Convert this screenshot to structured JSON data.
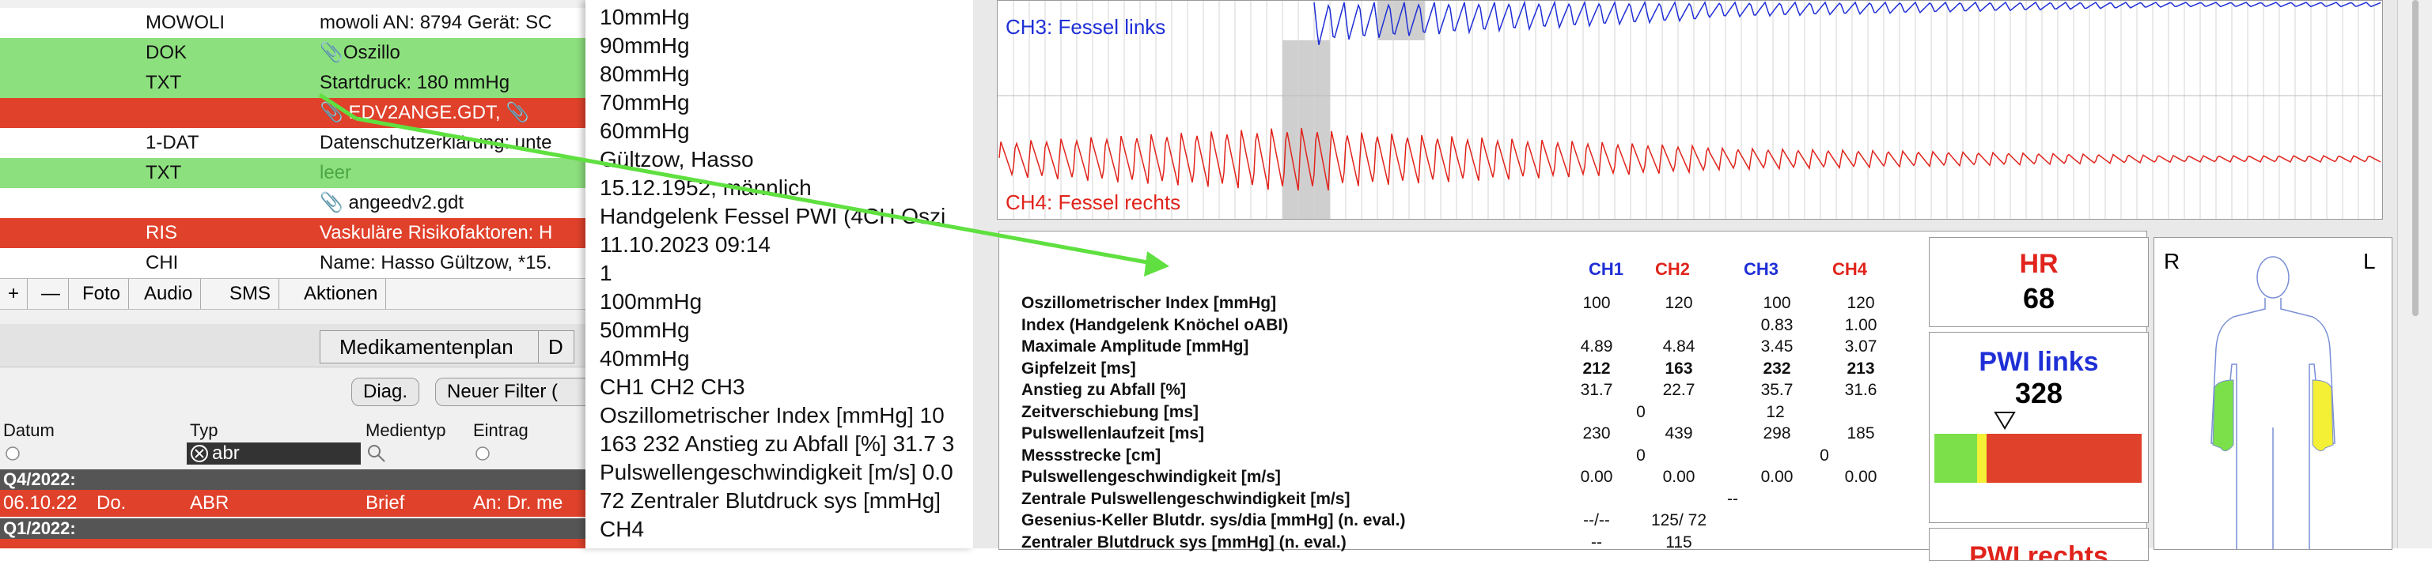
{
  "left_list": [
    {
      "c1": "MOWOLI",
      "c2": "mowoli AN: 8794 Gerät: SC",
      "style": "white"
    },
    {
      "c1": "DOK",
      "c2": "📎Oszillo",
      "style": "green"
    },
    {
      "c1": "TXT",
      "c2": "Startdruck: 180 mmHg",
      "style": "green"
    },
    {
      "c1": "",
      "c2": "📎 EDV2ANGE.GDT,  📎",
      "style": "red"
    },
    {
      "c1": "1-DAT",
      "c2": "Datenschutzerklärung: unte",
      "style": "white"
    },
    {
      "c1": "TXT",
      "c2": "leer",
      "style": "green"
    },
    {
      "c1": "",
      "c2": "📎 angeedv2.gdt",
      "style": "white"
    },
    {
      "c1": "RIS",
      "c2": "Vaskuläre Risikofaktoren: H",
      "style": "red"
    },
    {
      "c1": "CHI",
      "c2": "Name: Hasso Gültzow, *15.",
      "style": "white"
    }
  ],
  "toolbar": {
    "plus": "+",
    "minus": "—",
    "foto": "Foto",
    "audio": "Audio",
    "sms": "SMS",
    "aktionen": "Aktionen"
  },
  "buttons": {
    "medikamentenplan": "Medikamentenplan",
    "d": "D",
    "diag": "Diag.",
    "neuer_filter": "Neuer Filter ("
  },
  "columns": {
    "datum": "Datum",
    "typ": "Typ",
    "medientyp": "Medientyp",
    "eintrag": "Eintrag"
  },
  "filter": {
    "typ_value": "abr"
  },
  "groups": {
    "g1": "Q4/2022:",
    "g2": "Q1/2022:"
  },
  "data_rows": [
    {
      "datum": "06.10.22",
      "tag": "Do.",
      "typ": "ABR",
      "medientyp": "Brief",
      "eintrag": "An:  Dr. me"
    }
  ],
  "middle_lines": [
    "10mmHg",
    "90mmHg",
    "80mmHg",
    "70mmHg",
    "60mmHg",
    "Gültzow, Hasso",
    "15.12.1952, männlich",
    "Handgelenk Fessel PWI (4CH Oszi",
    "11.10.2023 09:14",
    " 1",
    "100mmHg",
    "50mmHg",
    "40mmHg",
    "     CH1 CH2 CH3",
    "Oszillometrischer Index [mmHg] 10",
    "163 232 Anstieg zu Abfall [%] 31.7 3",
    "Pulswellengeschwindigkeit [m/s] 0.0",
    "72 Zentraler Blutdruck sys [mmHg]",
    "CH4"
  ],
  "chart": {
    "ch3_label": "CH3: Fessel links",
    "ch4_label": "CH4: Fessel rechts",
    "ch3_color": "#1f2fd6",
    "ch4_color": "#e0241c"
  },
  "report": {
    "headers": [
      {
        "label": "CH1",
        "color": "#1f2fd6"
      },
      {
        "label": "CH2",
        "color": "#e0241c"
      },
      {
        "label": "CH3",
        "color": "#1f2fd6"
      },
      {
        "label": "CH4",
        "color": "#e0241c"
      }
    ],
    "rows": [
      {
        "label": "Oszillometrischer Index [mmHg]",
        "v": [
          "100",
          "120",
          "100",
          "120"
        ],
        "bold": false
      },
      {
        "label": "Index (Handgelenk Knöchel oABI)",
        "v": [
          "",
          "",
          "0.83",
          "1.00"
        ],
        "bold": false
      },
      {
        "label": "Maximale Amplitude [mmHg]",
        "v": [
          "4.89",
          "4.84",
          "3.45",
          "3.07"
        ],
        "bold": false
      },
      {
        "label": "Gipfelzeit [ms]",
        "v": [
          "212",
          "163",
          "232",
          "213"
        ],
        "bold": true
      },
      {
        "label": "Anstieg zu Abfall [%]",
        "v": [
          "31.7",
          "22.7",
          "35.7",
          "31.6"
        ],
        "bold": false
      },
      {
        "label": "Zeitverschiebung [ms]",
        "v": [
          "0",
          "",
          "12",
          ""
        ],
        "bold": false
      },
      {
        "label": "Pulswellenlaufzeit [ms]",
        "v": [
          "230",
          "439",
          "298",
          "185"
        ],
        "bold": false
      },
      {
        "label": "Messstrecke [cm]",
        "v": [
          "0",
          "",
          "0",
          ""
        ],
        "bold": false
      },
      {
        "label": "Pulswellengeschwindigkeit [m/s]",
        "v": [
          "0.00",
          "0.00",
          "0.00",
          "0.00"
        ],
        "bold": false
      },
      {
        "label": "Zentrale Pulswellengeschwindigkeit [m/s]",
        "v": [
          "",
          "--",
          "",
          ""
        ],
        "bold": false
      },
      {
        "label": "Gesenius-Keller Blutdr. sys/dia [mmHg] (n. eval.)",
        "v": [
          "--/--",
          "125/ 72",
          "",
          ""
        ],
        "bold": false
      },
      {
        "label": "Zentraler Blutdruck sys [mmHg] (n. eval.)",
        "v": [
          "--",
          "115",
          "",
          ""
        ],
        "bold": false
      }
    ]
  },
  "hr": {
    "label": "HR",
    "value": "68",
    "color": "#e0241c"
  },
  "pwi_links": {
    "label": "PWI links",
    "value": "328",
    "color": "#1f2fd6"
  },
  "pwi_rechts": {
    "label": "PWI rechts",
    "color": "#e0241c"
  },
  "body_figure": {
    "r": "R",
    "l": "L",
    "left_limb_color": "#7be04a",
    "right_limb_color": "#f3f036"
  },
  "colors": {
    "green_row": "#8de07e",
    "red_row": "#e0412b",
    "arrow": "#5fe040"
  }
}
